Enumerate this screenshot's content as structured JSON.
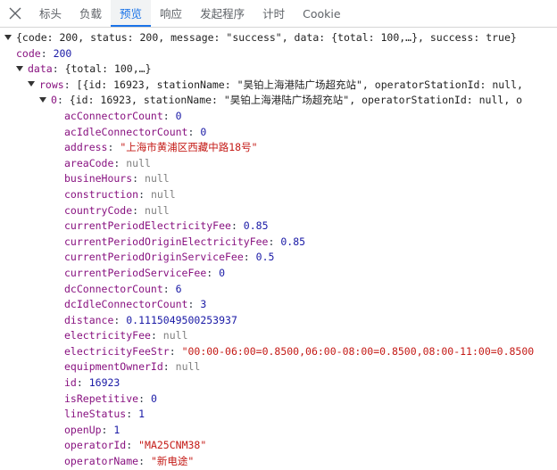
{
  "tabs": [
    {
      "label": "标头",
      "active": false
    },
    {
      "label": "负载",
      "active": false
    },
    {
      "label": "预览",
      "active": true
    },
    {
      "label": "响应",
      "active": false
    },
    {
      "label": "发起程序",
      "active": false
    },
    {
      "label": "计时",
      "active": false
    },
    {
      "label": "Cookie",
      "active": false
    }
  ],
  "tree": {
    "root_summary": "{code: 200, status: 200, message: \"success\", data: {total: 100,…}, success: true}",
    "code_key": "code",
    "code_value": "200",
    "data_key": "data",
    "data_summary": "{total: 100,…}",
    "rows_key": "rows",
    "rows_summary": "[{id: 16923, stationName: \"昊铂上海港陆广场超充站\", operatorStationId: null,",
    "item_key": "0",
    "item_summary": "{id: 16923, stationName: \"昊铂上海港陆广场超充站\", operatorStationId: null, o",
    "fields": [
      {
        "key": "acConnectorCount",
        "value": "0",
        "type": "num"
      },
      {
        "key": "acIdleConnectorCount",
        "value": "0",
        "type": "num"
      },
      {
        "key": "address",
        "value": "\"上海市黄浦区西藏中路18号\"",
        "type": "str"
      },
      {
        "key": "areaCode",
        "value": "null",
        "type": "nul"
      },
      {
        "key": "busineHours",
        "value": "null",
        "type": "nul"
      },
      {
        "key": "construction",
        "value": "null",
        "type": "nul"
      },
      {
        "key": "countryCode",
        "value": "null",
        "type": "nul"
      },
      {
        "key": "currentPeriodElectricityFee",
        "value": "0.85",
        "type": "num"
      },
      {
        "key": "currentPeriodOriginElectricityFee",
        "value": "0.85",
        "type": "num"
      },
      {
        "key": "currentPeriodOriginServiceFee",
        "value": "0.5",
        "type": "num"
      },
      {
        "key": "currentPeriodServiceFee",
        "value": "0",
        "type": "num"
      },
      {
        "key": "dcConnectorCount",
        "value": "6",
        "type": "num"
      },
      {
        "key": "dcIdleConnectorCount",
        "value": "3",
        "type": "num"
      },
      {
        "key": "distance",
        "value": "0.1115049500253937",
        "type": "num"
      },
      {
        "key": "electricityFee",
        "value": "null",
        "type": "nul"
      },
      {
        "key": "electricityFeeStr",
        "value": "\"00:00-06:00=0.8500,06:00-08:00=0.8500,08:00-11:00=0.8500",
        "type": "str"
      },
      {
        "key": "equipmentOwnerId",
        "value": "null",
        "type": "nul"
      },
      {
        "key": "id",
        "value": "16923",
        "type": "num"
      },
      {
        "key": "isRepetitive",
        "value": "0",
        "type": "num"
      },
      {
        "key": "lineStatus",
        "value": "1",
        "type": "num"
      },
      {
        "key": "openUp",
        "value": "1",
        "type": "num"
      },
      {
        "key": "operatorId",
        "value": "\"MA25CNM38\"",
        "type": "str"
      },
      {
        "key": "operatorName",
        "value": "\"新电途\"",
        "type": "str"
      }
    ]
  }
}
